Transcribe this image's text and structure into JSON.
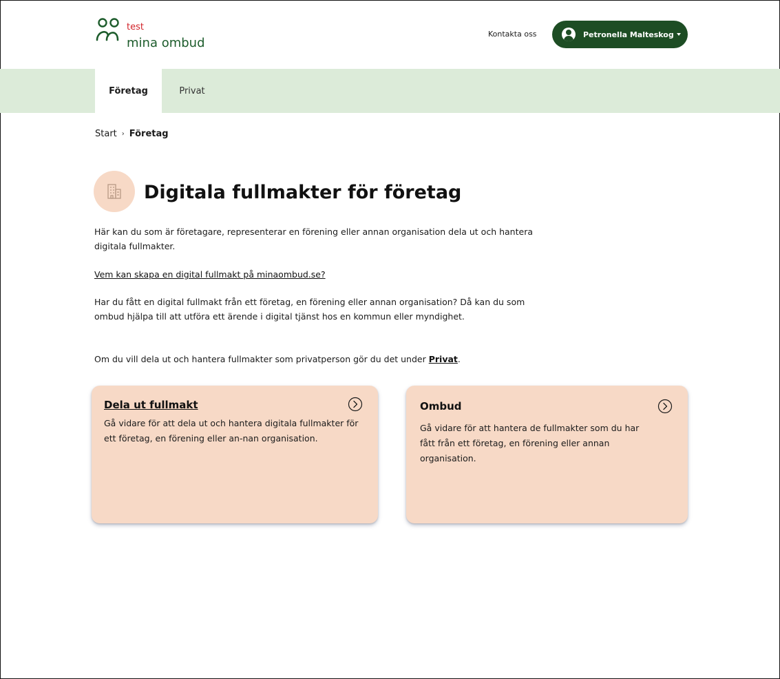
{
  "header": {
    "logo": {
      "badge": "test",
      "name": "mina ombud"
    },
    "contact_label": "Kontakta oss",
    "user": {
      "name": "Petronella Malteskog"
    }
  },
  "nav": {
    "tabs": [
      {
        "label": "Företag",
        "active": true
      },
      {
        "label": "Privat",
        "active": false
      }
    ]
  },
  "breadcrumb": {
    "items": [
      "Start",
      "Företag"
    ],
    "separator": "›"
  },
  "page": {
    "title": "Digitala fullmakter för företag",
    "intro": "Här kan du som är företagare, representerar en förening eller annan organisation dela ut och hantera digitala fullmakter.",
    "who_link": "Vem kan skapa en digital fullmakt på minaombud.se?",
    "received_text": "Har du fått en digital fullmakt från ett företag, en förening eller annan organisation? Då kan du som ombud hjälpa till att utföra ett ärende i digital tjänst hos en kommun eller myndighet.",
    "private_text_before": "Om du vill dela ut och hantera fullmakter som privatperson gör du det under ",
    "private_link": "Privat",
    "private_text_after": "."
  },
  "cards": [
    {
      "title": "Dela ut fullmakt",
      "description": "Gå vidare för att dela ut och hantera digitala fullmakter för ett företag, en förening eller an-nan organisation."
    },
    {
      "title": "Ombud",
      "description": "Gå vidare för att hantera de fullmakter som du har fått från ett företag, en förening eller annan organisation."
    }
  ],
  "colors": {
    "brand_green": "#1d4d24",
    "logo_green": "#1d5c2c",
    "logo_red": "#d2232a",
    "nav_background": "#dcebd9",
    "card_background": "#f7d9c6"
  },
  "icons": {
    "logo": "two-people-logo-icon",
    "user": "user-avatar-icon",
    "dropdown": "caret-down-icon",
    "title": "office-building-icon",
    "card_arrow": "circle-chevron-right-icon"
  }
}
